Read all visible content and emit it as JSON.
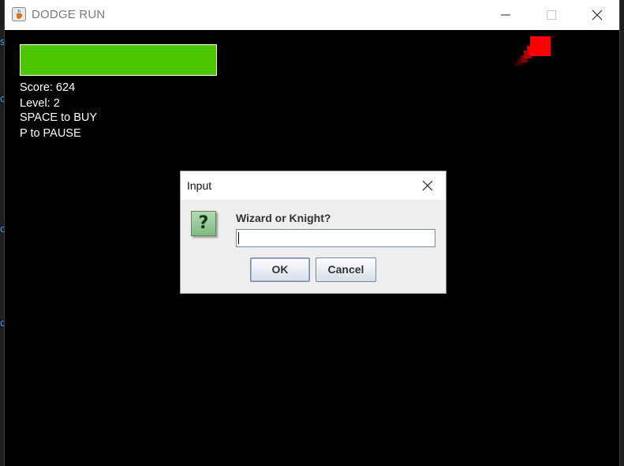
{
  "window": {
    "title": "DODGE RUN",
    "icon": "java-cup-icon",
    "controls": {
      "minimize_icon": "minimize-icon",
      "maximize_icon": "maximize-icon",
      "close_icon": "close-icon"
    }
  },
  "hud": {
    "health_fraction": 1.0,
    "health_color": "#4cc600",
    "score_text": "Score: 624",
    "level_text": "Level: 2",
    "buy_hint": "SPACE to BUY",
    "pause_hint": "P to PAUSE"
  },
  "enemy": {
    "color": "#ff0000",
    "shape": "square-with-trail"
  },
  "dialog": {
    "title": "Input",
    "close_icon": "close-icon",
    "icon": "question-icon",
    "icon_glyph": "?",
    "message": "Wizard or Knight?",
    "input_value": "",
    "ok_label": "OK",
    "cancel_label": "Cancel"
  }
}
